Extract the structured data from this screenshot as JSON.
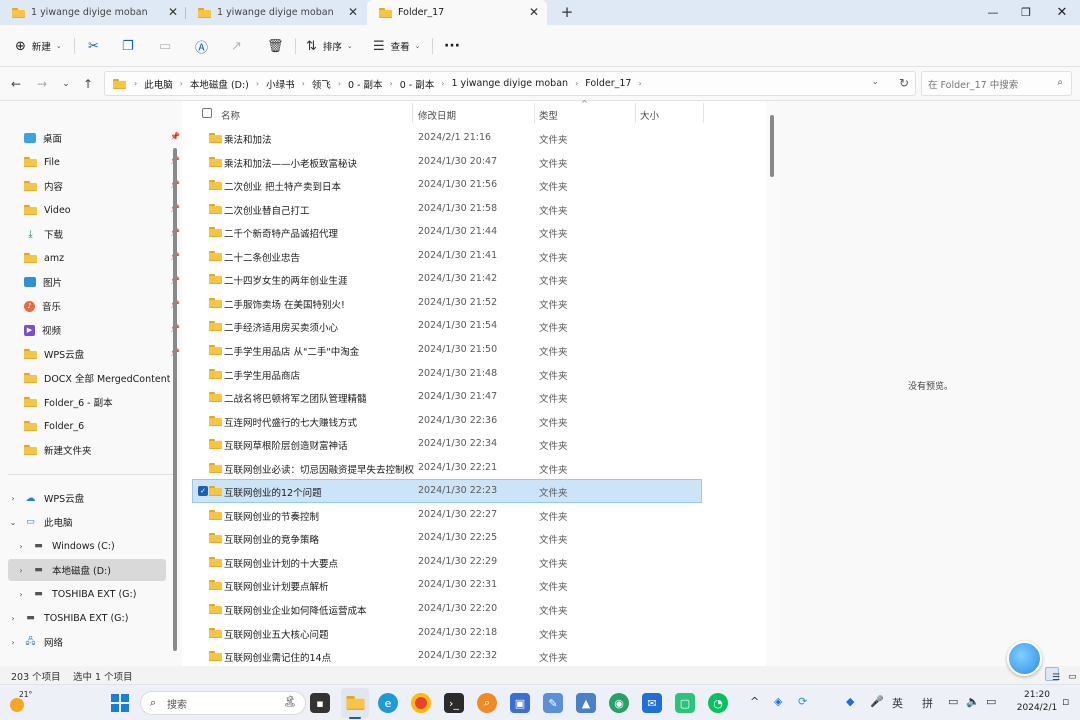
{
  "tabs": [
    {
      "label": "1 yiwange   diyige moban",
      "active": false
    },
    {
      "label": "1 yiwange   diyige moban",
      "active": false
    },
    {
      "label": "Folder_17",
      "active": true
    }
  ],
  "toolbar": {
    "new_label": "新建",
    "sort_label": "排序",
    "view_label": "查看"
  },
  "breadcrumb": [
    "此电脑",
    "本地磁盘 (D:)",
    "小绿书",
    "领飞",
    "0 - 副本",
    "0 - 副本",
    "1 yiwange   diyige moban",
    "Folder_17"
  ],
  "search": {
    "placeholder": "在 Folder_17 中搜索"
  },
  "sidebar": {
    "quick": [
      {
        "label": "桌面",
        "icon": "desktop-icon",
        "pinned": true
      },
      {
        "label": "File",
        "icon": "folder-icon",
        "pinned": true
      },
      {
        "label": "内容",
        "icon": "folder-icon",
        "pinned": true
      },
      {
        "label": "Video",
        "icon": "folder-icon",
        "pinned": true
      },
      {
        "label": "下载",
        "icon": "download-icon",
        "pinned": true
      },
      {
        "label": "amz",
        "icon": "folder-icon",
        "pinned": true
      },
      {
        "label": "图片",
        "icon": "pictures-icon",
        "pinned": true
      },
      {
        "label": "音乐",
        "icon": "music-icon",
        "pinned": true
      },
      {
        "label": "视频",
        "icon": "videos-icon",
        "pinned": true
      },
      {
        "label": "WPS云盘",
        "icon": "folder-icon",
        "pinned": true
      },
      {
        "label": "DOCX 全部 MergedContent -",
        "icon": "folder-icon",
        "pinned": false
      },
      {
        "label": "Folder_6 - 副本",
        "icon": "folder-icon",
        "pinned": false
      },
      {
        "label": "Folder_6",
        "icon": "folder-icon",
        "pinned": false
      },
      {
        "label": "新建文件夹",
        "icon": "folder-icon",
        "pinned": false
      }
    ],
    "tree": [
      {
        "label": "WPS云盘",
        "icon": "cloud-icon",
        "expander": "›",
        "indent": 0
      },
      {
        "label": "此电脑",
        "icon": "pc-icon",
        "expander": "⌄",
        "indent": 0
      },
      {
        "label": "Windows (C:)",
        "icon": "drive-icon",
        "expander": "›",
        "indent": 1
      },
      {
        "label": "本地磁盘 (D:)",
        "icon": "drive-icon",
        "expander": "›",
        "indent": 1,
        "selected": true
      },
      {
        "label": "TOSHIBA EXT (G:)",
        "icon": "drive-icon",
        "expander": "›",
        "indent": 1
      },
      {
        "label": "TOSHIBA EXT (G:)",
        "icon": "drive-icon",
        "expander": "›",
        "indent": 0
      },
      {
        "label": "网络",
        "icon": "network-icon",
        "expander": "›",
        "indent": 0
      }
    ]
  },
  "columns": {
    "name": "名称",
    "date": "修改日期",
    "type": "类型",
    "size": "大小"
  },
  "files": [
    {
      "name": "乘法和加法",
      "date": "2024/2/1 21:16",
      "type": "文件夹"
    },
    {
      "name": "乘法和加法——小老板致富秘诀",
      "date": "2024/1/30 20:47",
      "type": "文件夹"
    },
    {
      "name": "二次创业 把土特产卖到日本",
      "date": "2024/1/30 21:56",
      "type": "文件夹"
    },
    {
      "name": "二次创业替自己打工",
      "date": "2024/1/30 21:58",
      "type": "文件夹"
    },
    {
      "name": "二千个新奇特产品诚招代理",
      "date": "2024/1/30 21:44",
      "type": "文件夹"
    },
    {
      "name": "二十二条创业忠告",
      "date": "2024/1/30 21:41",
      "type": "文件夹"
    },
    {
      "name": "二十四岁女生的两年创业生涯",
      "date": "2024/1/30 21:42",
      "type": "文件夹"
    },
    {
      "name": "二手服饰卖场 在美国特别火!",
      "date": "2024/1/30 21:52",
      "type": "文件夹"
    },
    {
      "name": "二手经济适用房买卖须小心",
      "date": "2024/1/30 21:54",
      "type": "文件夹"
    },
    {
      "name": "二手学生用品店 从\"二手\"中淘金",
      "date": "2024/1/30 21:50",
      "type": "文件夹"
    },
    {
      "name": "二手学生用品商店",
      "date": "2024/1/30 21:48",
      "type": "文件夹"
    },
    {
      "name": "二战名将巴顿将军之团队管理精髓",
      "date": "2024/1/30 21:47",
      "type": "文件夹"
    },
    {
      "name": "互连网时代盛行的七大赚钱方式",
      "date": "2024/1/30 22:36",
      "type": "文件夹"
    },
    {
      "name": "互联网草根阶层创造财富神话",
      "date": "2024/1/30 22:34",
      "type": "文件夹"
    },
    {
      "name": "互联网创业必读：切忌因融资提早失去控制权",
      "date": "2024/1/30 22:21",
      "type": "文件夹"
    },
    {
      "name": "互联网创业的12个问题",
      "date": "2024/1/30 22:23",
      "type": "文件夹",
      "selected": true
    },
    {
      "name": "互联网创业的节奏控制",
      "date": "2024/1/30 22:27",
      "type": "文件夹"
    },
    {
      "name": "互联网创业的竞争策略",
      "date": "2024/1/30 22:25",
      "type": "文件夹"
    },
    {
      "name": "互联网创业计划的十大要点",
      "date": "2024/1/30 22:29",
      "type": "文件夹"
    },
    {
      "name": "互联网创业计划要点解析",
      "date": "2024/1/30 22:31",
      "type": "文件夹"
    },
    {
      "name": "互联网创业企业如何降低运营成本",
      "date": "2024/1/30 22:20",
      "type": "文件夹"
    },
    {
      "name": "互联网创业五大核心问题",
      "date": "2024/1/30 22:18",
      "type": "文件夹"
    },
    {
      "name": "互联网创业需记住的14点",
      "date": "2024/1/30 22:32",
      "type": "文件夹"
    }
  ],
  "preview": {
    "message": "没有预览。"
  },
  "status": {
    "count": "203 个项目",
    "selected": "选中 1 个项目"
  },
  "taskbar": {
    "weather_temp": "21°",
    "search_label": "搜索",
    "ime_lang": "英",
    "ime_mode": "拼",
    "time": "21:20",
    "date": "2024/2/1"
  }
}
